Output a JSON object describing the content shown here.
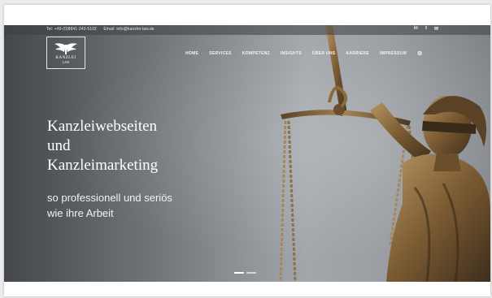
{
  "topbar": {
    "phone": "Tel: +49-(0)8841-243-5102",
    "email": "Email: info@kanzlei-law.de"
  },
  "social": {
    "items": [
      "in",
      "t",
      "✉"
    ]
  },
  "logo": {
    "text": "KANZLEI",
    "sub": "LAW"
  },
  "nav": {
    "items": [
      "HOME",
      "SERVICES",
      "KOMPETENZ",
      "INSIGHTS",
      "ÜBER UNS",
      "KARRIERE",
      "IMPRESSUM"
    ],
    "gear_icon": "gear-icon"
  },
  "hero": {
    "headline_lines": [
      "Kanzleiwebseiten",
      "und",
      "Kanzleimarketing"
    ],
    "sub_lines": [
      "so professionell und seriös",
      "wie ihre Arbeit"
    ]
  },
  "slider": {
    "count": 2,
    "active": 0
  },
  "colors": {
    "hero_dark": "#44484d",
    "hero_light": "#a3a7ab",
    "bronze": "#8a6a3c",
    "text": "#ffffff"
  }
}
